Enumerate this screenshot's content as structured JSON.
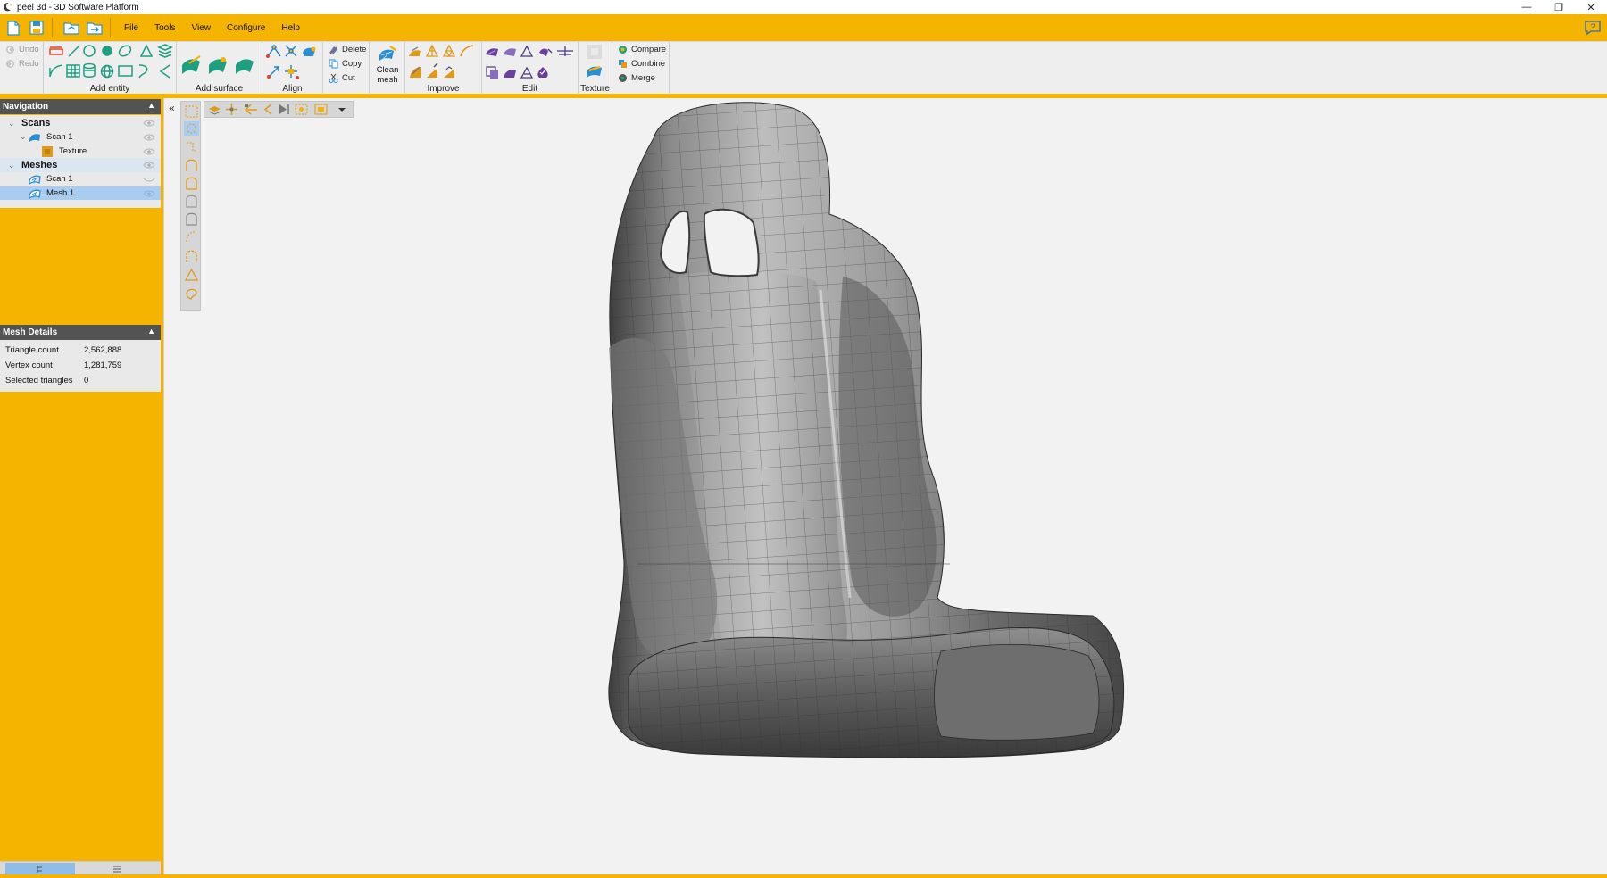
{
  "window": {
    "title": "peel 3d - 3D Software Platform",
    "controls": [
      "—",
      "❐",
      "✕"
    ]
  },
  "menu": {
    "items": [
      "File",
      "Tools",
      "View",
      "Configure",
      "Help"
    ]
  },
  "ribbon": {
    "undo_label": "Undo",
    "redo_label": "Redo",
    "groups": {
      "add_entity": "Add entity",
      "add_surface": "Add surface",
      "align": "Align",
      "improve": "Improve",
      "edit": "Edit",
      "texture": "Texture"
    },
    "edit_ops": {
      "delete": "Delete",
      "copy": "Copy",
      "cut": "Cut"
    },
    "clean_mesh": [
      "Clean",
      "mesh"
    ],
    "combine_ops": {
      "compare": "Compare",
      "combine": "Combine",
      "merge": "Merge"
    }
  },
  "navigation": {
    "title": "Navigation",
    "tree": {
      "scans_label": "Scans",
      "scan1_label": "Scan 1",
      "texture_label": "Texture",
      "meshes_label": "Meshes",
      "mesh_scan1_label": "Scan 1",
      "mesh1_label": "Mesh 1"
    }
  },
  "mesh_details": {
    "title": "Mesh Details",
    "rows": [
      {
        "key": "Triangle count",
        "value": "2,562,888"
      },
      {
        "key": "Vertex count",
        "value": "1,281,759"
      },
      {
        "key": "Selected triangles",
        "value": "0"
      }
    ]
  },
  "colors": {
    "accent": "#f4b400",
    "panel_header": "#535353",
    "selection": "#a8cdf0",
    "entity_green": "#1f9e80",
    "mesh_blue": "#2b8fd6",
    "edit_purple": "#6b3fa0"
  },
  "viewport": {
    "model": "car-seat-mesh"
  }
}
